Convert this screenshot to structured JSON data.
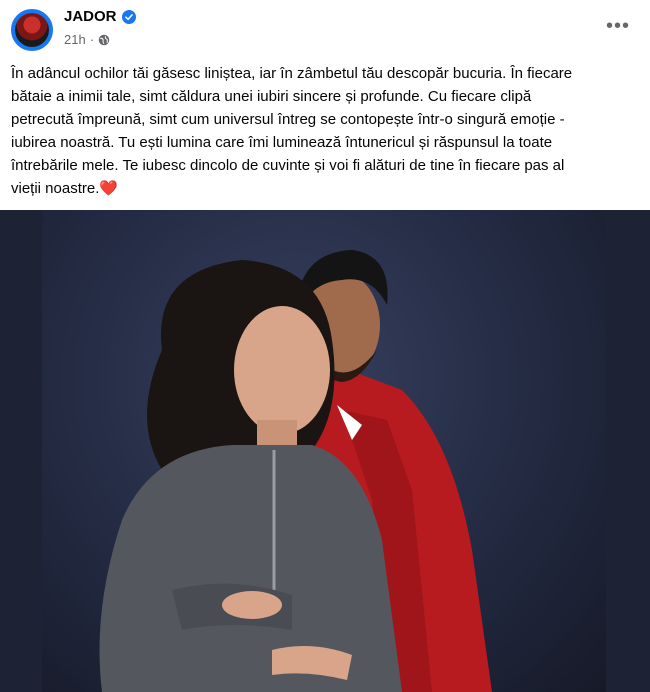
{
  "post": {
    "author": "JADOR",
    "time": "21h",
    "dot": "·",
    "more": "•••",
    "caption": "În adâncul ochilor tăi găsesc liniștea, iar în zâmbetul tău descopăr bucuria. În fiecare\nbătaie a inimii tale, simt căldura unei iubiri sincere și profunde. Cu fiecare clipă\npetrecută împreună, simt cum universul întreg se contopește într-o singură emoție -\niubirea noastră. Tu ești lumina care îmi luminează întunericul și răspunsul la toate\nîntrebările mele. Te iubesc dincolo de cuvinte și voi fi alături de tine în fiecare pas al\nvieții noastre.❤️"
  },
  "colors": {
    "verified": "#1877f2",
    "text": "#050505",
    "secondary": "#65676b",
    "photo_bg": "#1d2234"
  },
  "icons": [
    "verified-badge-icon",
    "globe-icon",
    "more-options-icon"
  ]
}
